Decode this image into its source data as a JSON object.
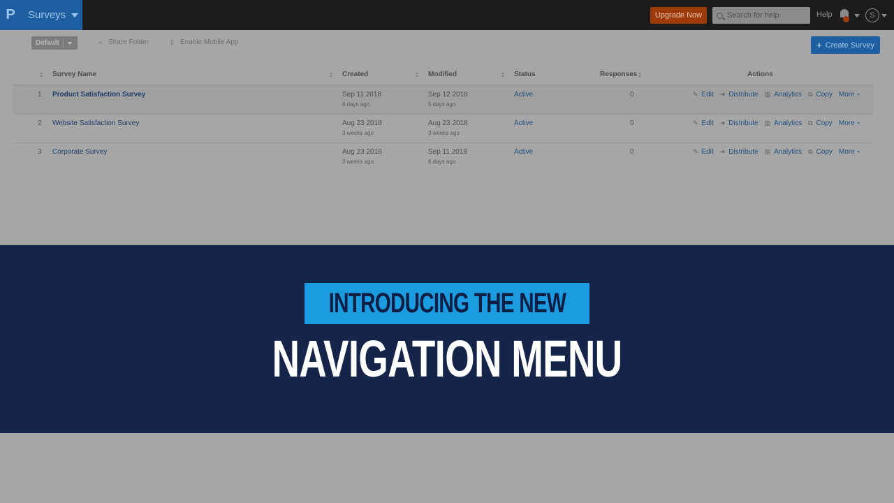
{
  "topbar": {
    "logo": "P",
    "app_title": "Surveys",
    "upgrade_label": "Upgrade Now",
    "search_placeholder": "Search for help",
    "help_label": "Help",
    "avatar_initial": "S"
  },
  "toolbar": {
    "folder_select": "Default",
    "share_folder": "Share Folder",
    "enable_mobile": "Enable Mobile App",
    "create_survey": "Create Survey"
  },
  "table": {
    "headers": {
      "name": "Survey Name",
      "created": "Created",
      "modified": "Modified",
      "status": "Status",
      "responses": "Responses",
      "actions": "Actions"
    },
    "action_labels": {
      "edit": "Edit",
      "distribute": "Distribute",
      "analytics": "Analytics",
      "copy": "Copy",
      "more": "More"
    },
    "rows": [
      {
        "num": "1",
        "name": "Product Satisfaction Survey",
        "created": "Sep 11 2018",
        "created_ago": "6 days ago",
        "modified": "Sep 12 2018",
        "modified_ago": "5 days ago",
        "status": "Active",
        "responses": "0"
      },
      {
        "num": "2",
        "name": "Website Satisfaction Survey",
        "created": "Aug 23 2018",
        "created_ago": "3 weeks ago",
        "modified": "Aug 23 2018",
        "modified_ago": "3 weeks ago",
        "status": "Active",
        "responses": "0"
      },
      {
        "num": "3",
        "name": "Corporate Survey",
        "created": "Aug 23 2018",
        "created_ago": "3 weeks ago",
        "modified": "Sep 11 2018",
        "modified_ago": "6 days ago",
        "status": "Active",
        "responses": "0"
      }
    ]
  },
  "banner": {
    "intro": "INTRODUCING THE NEW",
    "headline": "NAVIGATION MENU"
  },
  "colors": {
    "brand_blue": "#1d5fa0",
    "upgrade_orange": "#9e3a0a",
    "banner_navy": "#152449",
    "intro_cyan": "#1b9be0"
  }
}
